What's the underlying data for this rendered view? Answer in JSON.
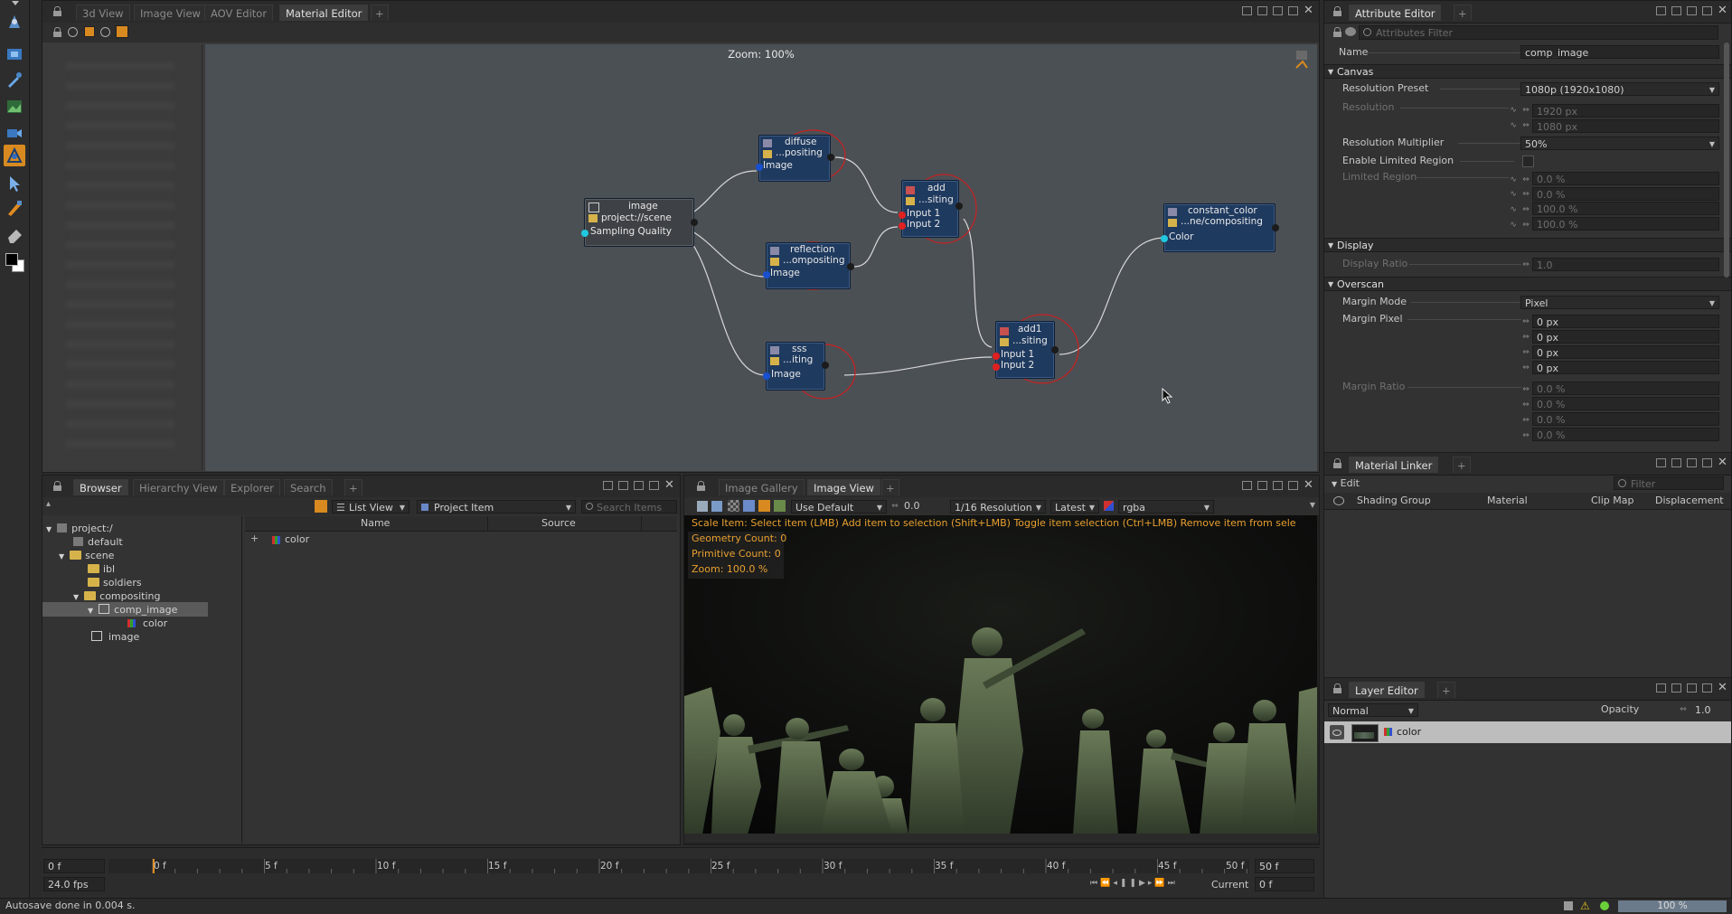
{
  "left_toolbar": {
    "tools": [
      "transform-tool-icon",
      "render-region-icon",
      "color-picker-icon",
      "image-layer-icon",
      "camera-icon",
      "mesh-tool-icon",
      "select-arrow-icon",
      "paint-brush-icon",
      "eraser-icon"
    ]
  },
  "material_editor": {
    "tabs": [
      "3d View",
      "Image View",
      "AOV Editor",
      "Material Editor"
    ],
    "active_tab": "Material Editor",
    "zoom_label": "Zoom: 100%",
    "nodes": {
      "image": {
        "title": "image",
        "sub": "project://scene",
        "port": "Sampling Quality"
      },
      "diffuse": {
        "title": "diffuse",
        "sub": "...positing",
        "port": "Image"
      },
      "reflection": {
        "title": "reflection",
        "sub": "...ompositing",
        "port": "Image"
      },
      "sss": {
        "title": "sss",
        "sub": "...iting",
        "port": "Image"
      },
      "add": {
        "title": "add",
        "sub": "...siting",
        "port1": "Input 1",
        "port2": "Input 2"
      },
      "add1": {
        "title": "add1",
        "sub": "...siting",
        "port1": "Input 1",
        "port2": "Input 2"
      },
      "constant_color": {
        "title": "constant_color",
        "sub": "...ne/compositing",
        "port": "Color"
      }
    }
  },
  "attribute_editor": {
    "tab": "Attribute Editor",
    "filter_placeholder": "Attributes Filter",
    "name_label": "Name",
    "name_value": "comp_image",
    "sections": {
      "canvas": "Canvas",
      "display": "Display",
      "overscan": "Overscan"
    },
    "resolution_preset_label": "Resolution Preset",
    "resolution_preset_value": "1080p (1920x1080)",
    "resolution_label": "Resolution",
    "resolution_w": "1920 px",
    "resolution_h": "1080 px",
    "resolution_multiplier_label": "Resolution Multiplier",
    "resolution_multiplier_value": "50%",
    "enable_limited_region_label": "Enable Limited Region",
    "limited_region_label": "Limited Region",
    "limited_region_values": [
      "0.0 %",
      "0.0 %",
      "100.0 %",
      "100.0 %"
    ],
    "display_ratio_label": "Display Ratio",
    "display_ratio_value": "1.0",
    "margin_mode_label": "Margin Mode",
    "margin_mode_value": "Pixel",
    "margin_pixel_label": "Margin Pixel",
    "margin_pixel_values": [
      "0 px",
      "0 px",
      "0 px",
      "0 px"
    ],
    "margin_ratio_label": "Margin Ratio",
    "margin_ratio_values": [
      "0.0 %",
      "0.0 %",
      "0.0 %",
      "0.0 %"
    ]
  },
  "material_linker": {
    "tab": "Material Linker",
    "edit_label": "Edit",
    "filter_placeholder": "Filter",
    "columns": [
      "Shading Group",
      "Material",
      "Clip Map",
      "Displacement"
    ]
  },
  "layer_editor": {
    "tab": "Layer Editor",
    "blend_mode": "Normal",
    "opacity_label": "Opacity",
    "opacity_value": "1.0",
    "layers": [
      {
        "name": "color"
      }
    ]
  },
  "browser": {
    "tabs": [
      "Browser",
      "Hierarchy View",
      "Explorer",
      "Search"
    ],
    "active_tab": "Browser",
    "view_mode": "List View",
    "item_type": "Project Item",
    "search_placeholder": "Search Items",
    "tree": [
      {
        "label": "project:/",
        "level": 0,
        "kind": "project"
      },
      {
        "label": "default",
        "level": 1,
        "kind": "context"
      },
      {
        "label": "scene",
        "level": 1,
        "kind": "folder"
      },
      {
        "label": "ibl",
        "level": 2,
        "kind": "folder"
      },
      {
        "label": "soldiers",
        "level": 2,
        "kind": "folder"
      },
      {
        "label": "compositing",
        "level": 2,
        "kind": "folder"
      },
      {
        "label": "comp_image",
        "level": 3,
        "kind": "image",
        "selected": true
      },
      {
        "label": "color",
        "level": 4,
        "kind": "color"
      },
      {
        "label": "image",
        "level": 2,
        "kind": "image"
      }
    ],
    "list_columns": [
      "Name",
      "Source"
    ],
    "list_rows": [
      {
        "name": "color",
        "source": ""
      }
    ]
  },
  "image_view": {
    "tabs": [
      "Image Gallery",
      "Image View"
    ],
    "active_tab": "Image View",
    "lut": "Use Default",
    "exposure": "0.0",
    "resolution": "1/16 Resolution",
    "version": "Latest",
    "channels": "rgba",
    "hint": "Scale Item: Select item (LMB)  Add item to selection (Shift+LMB)  Toggle item selection (Ctrl+LMB)  Remove item from sele",
    "overlay": [
      "Geometry Count: 0",
      "Primitive Count: 0",
      "Zoom: 100.0 %"
    ]
  },
  "timeline": {
    "start": "0 f",
    "end": "50 f",
    "fps": "24.0 fps",
    "current_label": "Current",
    "current_value": "0 f",
    "ticks": [
      "0 f",
      "5 f",
      "10 f",
      "15 f",
      "20 f",
      "25 f",
      "30 f",
      "35 f",
      "40 f",
      "45 f",
      "50 f"
    ]
  },
  "status": {
    "message": "Autosave done in 0.004 s.",
    "progress_percent": "100 %"
  },
  "colors": {
    "node_fill": "#1f3a5f",
    "wire": "#d8d8d8",
    "highlight_circle": "#cc2020",
    "hint_text": "#e8a030",
    "accent_orange": "#e08a20"
  }
}
